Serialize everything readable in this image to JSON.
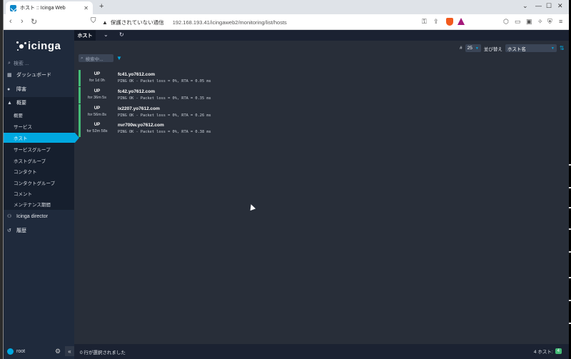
{
  "browser": {
    "tab_title": "ホスト :: Icinga Web",
    "security_label": "保護されていない通信",
    "url": "192.168.193.41/icingaweb2/monitoring/list/hosts"
  },
  "sidebar": {
    "logo": "icinga",
    "search_placeholder": "検索 ...",
    "items": [
      {
        "label": "ダッシュボード",
        "icon": "dashboard-icon"
      },
      {
        "label": "障害",
        "icon": "problems-icon"
      },
      {
        "label": "概要",
        "icon": "overview-icon"
      }
    ],
    "sub_items": [
      "概要",
      "サービス",
      "ホスト",
      "サービスグループ",
      "ホストグループ",
      "コンタクト",
      "コンタクトグループ",
      "コメント",
      "メンテナンス期間"
    ],
    "director": "Icinga director",
    "history": "履歴",
    "user": "root"
  },
  "main": {
    "tab_label": "ホスト",
    "limit_label": "#",
    "limit_value": "25",
    "sort_label": "並び替え",
    "sort_value": "ホスト名",
    "filter_placeholder": "検索中...",
    "hosts": [
      {
        "state": "UP",
        "since": "for 1d 0h",
        "name": "fc41.yo7612.com",
        "output": "PING OK - Packet loss = 0%, RTA = 0.05 ms"
      },
      {
        "state": "UP",
        "since": "for 36m 5s",
        "name": "fc42.yo7612.com",
        "output": "PING OK - Packet loss = 0%, RTA = 0.35 ms"
      },
      {
        "state": "UP",
        "since": "for 56m 8s",
        "name": "ix2207.yo7612.com",
        "output": "PING OK - Packet loss = 0%, RTA = 0.26 ms"
      },
      {
        "state": "UP",
        "since": "for 52m 58s",
        "name": "nvr700w.yo7612.com",
        "output": "PING OK - Packet loss = 0%, RTA = 0.38 ms"
      }
    ],
    "footer_selected": "0 行が選択されました",
    "footer_count_label": "4 ホスト:",
    "footer_badge": "4"
  },
  "colors": {
    "accent": "#00a8e0",
    "up": "#44bb77",
    "sidebar": "#1f2a3c",
    "content": "#282e39"
  }
}
